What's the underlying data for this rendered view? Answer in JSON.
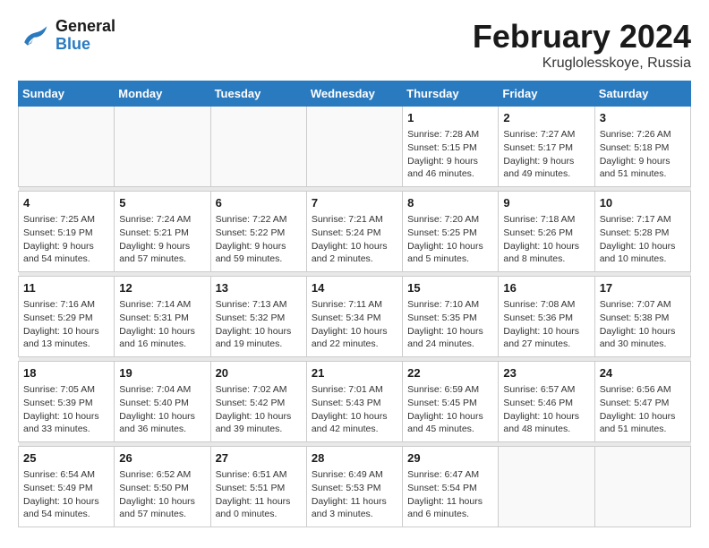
{
  "header": {
    "logo_line1": "General",
    "logo_line2": "Blue",
    "title": "February 2024",
    "subtitle": "Kruglolesskoye, Russia"
  },
  "weekdays": [
    "Sunday",
    "Monday",
    "Tuesday",
    "Wednesday",
    "Thursday",
    "Friday",
    "Saturday"
  ],
  "weeks": [
    [
      {
        "day": "",
        "sunrise": "",
        "sunset": "",
        "daylight": ""
      },
      {
        "day": "",
        "sunrise": "",
        "sunset": "",
        "daylight": ""
      },
      {
        "day": "",
        "sunrise": "",
        "sunset": "",
        "daylight": ""
      },
      {
        "day": "",
        "sunrise": "",
        "sunset": "",
        "daylight": ""
      },
      {
        "day": "1",
        "sunrise": "Sunrise: 7:28 AM",
        "sunset": "Sunset: 5:15 PM",
        "daylight": "Daylight: 9 hours and 46 minutes."
      },
      {
        "day": "2",
        "sunrise": "Sunrise: 7:27 AM",
        "sunset": "Sunset: 5:17 PM",
        "daylight": "Daylight: 9 hours and 49 minutes."
      },
      {
        "day": "3",
        "sunrise": "Sunrise: 7:26 AM",
        "sunset": "Sunset: 5:18 PM",
        "daylight": "Daylight: 9 hours and 51 minutes."
      }
    ],
    [
      {
        "day": "4",
        "sunrise": "Sunrise: 7:25 AM",
        "sunset": "Sunset: 5:19 PM",
        "daylight": "Daylight: 9 hours and 54 minutes."
      },
      {
        "day": "5",
        "sunrise": "Sunrise: 7:24 AM",
        "sunset": "Sunset: 5:21 PM",
        "daylight": "Daylight: 9 hours and 57 minutes."
      },
      {
        "day": "6",
        "sunrise": "Sunrise: 7:22 AM",
        "sunset": "Sunset: 5:22 PM",
        "daylight": "Daylight: 9 hours and 59 minutes."
      },
      {
        "day": "7",
        "sunrise": "Sunrise: 7:21 AM",
        "sunset": "Sunset: 5:24 PM",
        "daylight": "Daylight: 10 hours and 2 minutes."
      },
      {
        "day": "8",
        "sunrise": "Sunrise: 7:20 AM",
        "sunset": "Sunset: 5:25 PM",
        "daylight": "Daylight: 10 hours and 5 minutes."
      },
      {
        "day": "9",
        "sunrise": "Sunrise: 7:18 AM",
        "sunset": "Sunset: 5:26 PM",
        "daylight": "Daylight: 10 hours and 8 minutes."
      },
      {
        "day": "10",
        "sunrise": "Sunrise: 7:17 AM",
        "sunset": "Sunset: 5:28 PM",
        "daylight": "Daylight: 10 hours and 10 minutes."
      }
    ],
    [
      {
        "day": "11",
        "sunrise": "Sunrise: 7:16 AM",
        "sunset": "Sunset: 5:29 PM",
        "daylight": "Daylight: 10 hours and 13 minutes."
      },
      {
        "day": "12",
        "sunrise": "Sunrise: 7:14 AM",
        "sunset": "Sunset: 5:31 PM",
        "daylight": "Daylight: 10 hours and 16 minutes."
      },
      {
        "day": "13",
        "sunrise": "Sunrise: 7:13 AM",
        "sunset": "Sunset: 5:32 PM",
        "daylight": "Daylight: 10 hours and 19 minutes."
      },
      {
        "day": "14",
        "sunrise": "Sunrise: 7:11 AM",
        "sunset": "Sunset: 5:34 PM",
        "daylight": "Daylight: 10 hours and 22 minutes."
      },
      {
        "day": "15",
        "sunrise": "Sunrise: 7:10 AM",
        "sunset": "Sunset: 5:35 PM",
        "daylight": "Daylight: 10 hours and 24 minutes."
      },
      {
        "day": "16",
        "sunrise": "Sunrise: 7:08 AM",
        "sunset": "Sunset: 5:36 PM",
        "daylight": "Daylight: 10 hours and 27 minutes."
      },
      {
        "day": "17",
        "sunrise": "Sunrise: 7:07 AM",
        "sunset": "Sunset: 5:38 PM",
        "daylight": "Daylight: 10 hours and 30 minutes."
      }
    ],
    [
      {
        "day": "18",
        "sunrise": "Sunrise: 7:05 AM",
        "sunset": "Sunset: 5:39 PM",
        "daylight": "Daylight: 10 hours and 33 minutes."
      },
      {
        "day": "19",
        "sunrise": "Sunrise: 7:04 AM",
        "sunset": "Sunset: 5:40 PM",
        "daylight": "Daylight: 10 hours and 36 minutes."
      },
      {
        "day": "20",
        "sunrise": "Sunrise: 7:02 AM",
        "sunset": "Sunset: 5:42 PM",
        "daylight": "Daylight: 10 hours and 39 minutes."
      },
      {
        "day": "21",
        "sunrise": "Sunrise: 7:01 AM",
        "sunset": "Sunset: 5:43 PM",
        "daylight": "Daylight: 10 hours and 42 minutes."
      },
      {
        "day": "22",
        "sunrise": "Sunrise: 6:59 AM",
        "sunset": "Sunset: 5:45 PM",
        "daylight": "Daylight: 10 hours and 45 minutes."
      },
      {
        "day": "23",
        "sunrise": "Sunrise: 6:57 AM",
        "sunset": "Sunset: 5:46 PM",
        "daylight": "Daylight: 10 hours and 48 minutes."
      },
      {
        "day": "24",
        "sunrise": "Sunrise: 6:56 AM",
        "sunset": "Sunset: 5:47 PM",
        "daylight": "Daylight: 10 hours and 51 minutes."
      }
    ],
    [
      {
        "day": "25",
        "sunrise": "Sunrise: 6:54 AM",
        "sunset": "Sunset: 5:49 PM",
        "daylight": "Daylight: 10 hours and 54 minutes."
      },
      {
        "day": "26",
        "sunrise": "Sunrise: 6:52 AM",
        "sunset": "Sunset: 5:50 PM",
        "daylight": "Daylight: 10 hours and 57 minutes."
      },
      {
        "day": "27",
        "sunrise": "Sunrise: 6:51 AM",
        "sunset": "Sunset: 5:51 PM",
        "daylight": "Daylight: 11 hours and 0 minutes."
      },
      {
        "day": "28",
        "sunrise": "Sunrise: 6:49 AM",
        "sunset": "Sunset: 5:53 PM",
        "daylight": "Daylight: 11 hours and 3 minutes."
      },
      {
        "day": "29",
        "sunrise": "Sunrise: 6:47 AM",
        "sunset": "Sunset: 5:54 PM",
        "daylight": "Daylight: 11 hours and 6 minutes."
      },
      {
        "day": "",
        "sunrise": "",
        "sunset": "",
        "daylight": ""
      },
      {
        "day": "",
        "sunrise": "",
        "sunset": "",
        "daylight": ""
      }
    ]
  ]
}
